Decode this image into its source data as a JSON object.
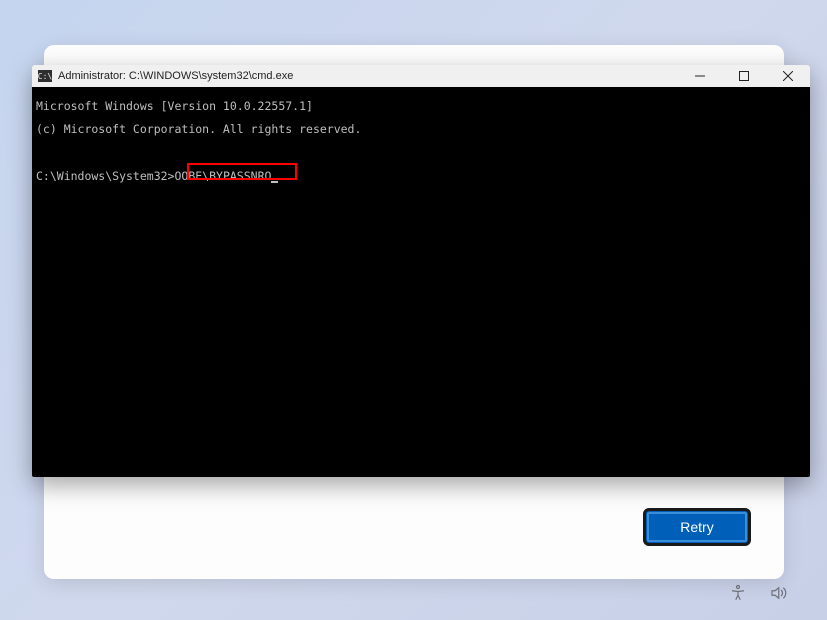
{
  "oobe": {
    "retry_label": "Retry"
  },
  "cmd": {
    "title": "Administrator: C:\\WINDOWS\\system32\\cmd.exe",
    "line1": "Microsoft Windows [Version 10.0.22557.1]",
    "line2": "(c) Microsoft Corporation. All rights reserved.",
    "prompt": "C:\\Windows\\System32>",
    "command": "OOBE\\BYPASSNRO"
  }
}
